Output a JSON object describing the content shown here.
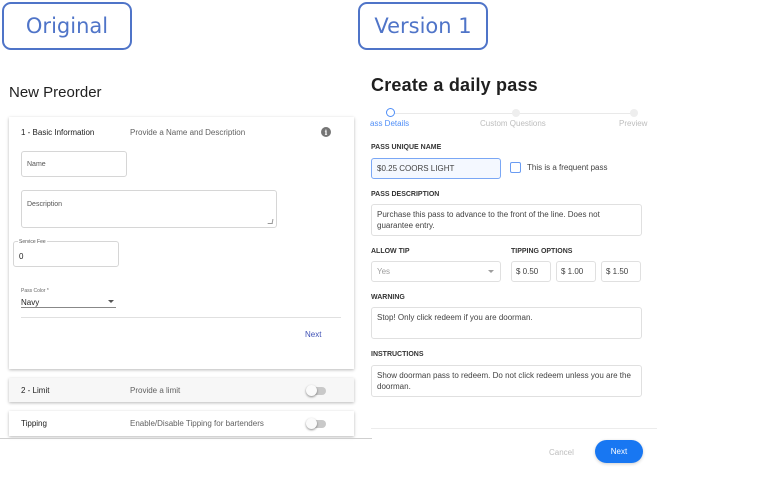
{
  "labels": {
    "original": "Original",
    "version": "Version 1"
  },
  "original": {
    "title": "New Preorder",
    "basic": {
      "step_title": "1 - Basic Information",
      "step_desc": "Provide a Name and Description",
      "info_icon": "i",
      "name_label": "Name",
      "description_label": "Description",
      "service_fee_label": "Service Fee",
      "service_fee_value": "0",
      "pass_color_label": "Pass Color *",
      "pass_color_value": "Navy",
      "next_label": "Next"
    },
    "limit": {
      "step_title": "2 - Limit",
      "step_desc": "Provide a limit",
      "enabled": false
    },
    "tipping": {
      "step_title": "Tipping",
      "step_desc": "Enable/Disable Tipping for bartenders",
      "enabled": false
    }
  },
  "version1": {
    "title": "Create a daily pass",
    "steps": [
      {
        "label": "ass Details",
        "active": true
      },
      {
        "label": "Custom Questions",
        "active": false
      },
      {
        "label": "Preview",
        "active": false
      }
    ],
    "pass_name_label": "PASS UNIQUE NAME",
    "pass_name_value": "$0.25 COORS LIGHT",
    "frequent_label": "This is a frequent pass",
    "pass_desc_label": "PASS DESCRIPTION",
    "pass_desc_value": "Purchase this pass to advance to the front of the line. Does not guarantee entry.",
    "allow_tip_label": "ALLOW TIP",
    "allow_tip_value": "Yes",
    "tipping_options_label": "TIPPING OPTIONS",
    "tipping_options": [
      "$ 0.50",
      "$ 1.00",
      "$ 1.50"
    ],
    "warning_label": "WARNING",
    "warning_value": "Stop! Only click redeem if you are doorman.",
    "instructions_label": "INSTRUCTIONS",
    "instructions_value": "Show doorman pass to redeem. Do not click redeem unless you are the doorman.",
    "cancel_label": "Cancel",
    "next_label": "Next"
  },
  "colors": {
    "accent_blue": "#1877f2",
    "label_blue": "#4f74c8",
    "indigo": "#3f51b5"
  }
}
